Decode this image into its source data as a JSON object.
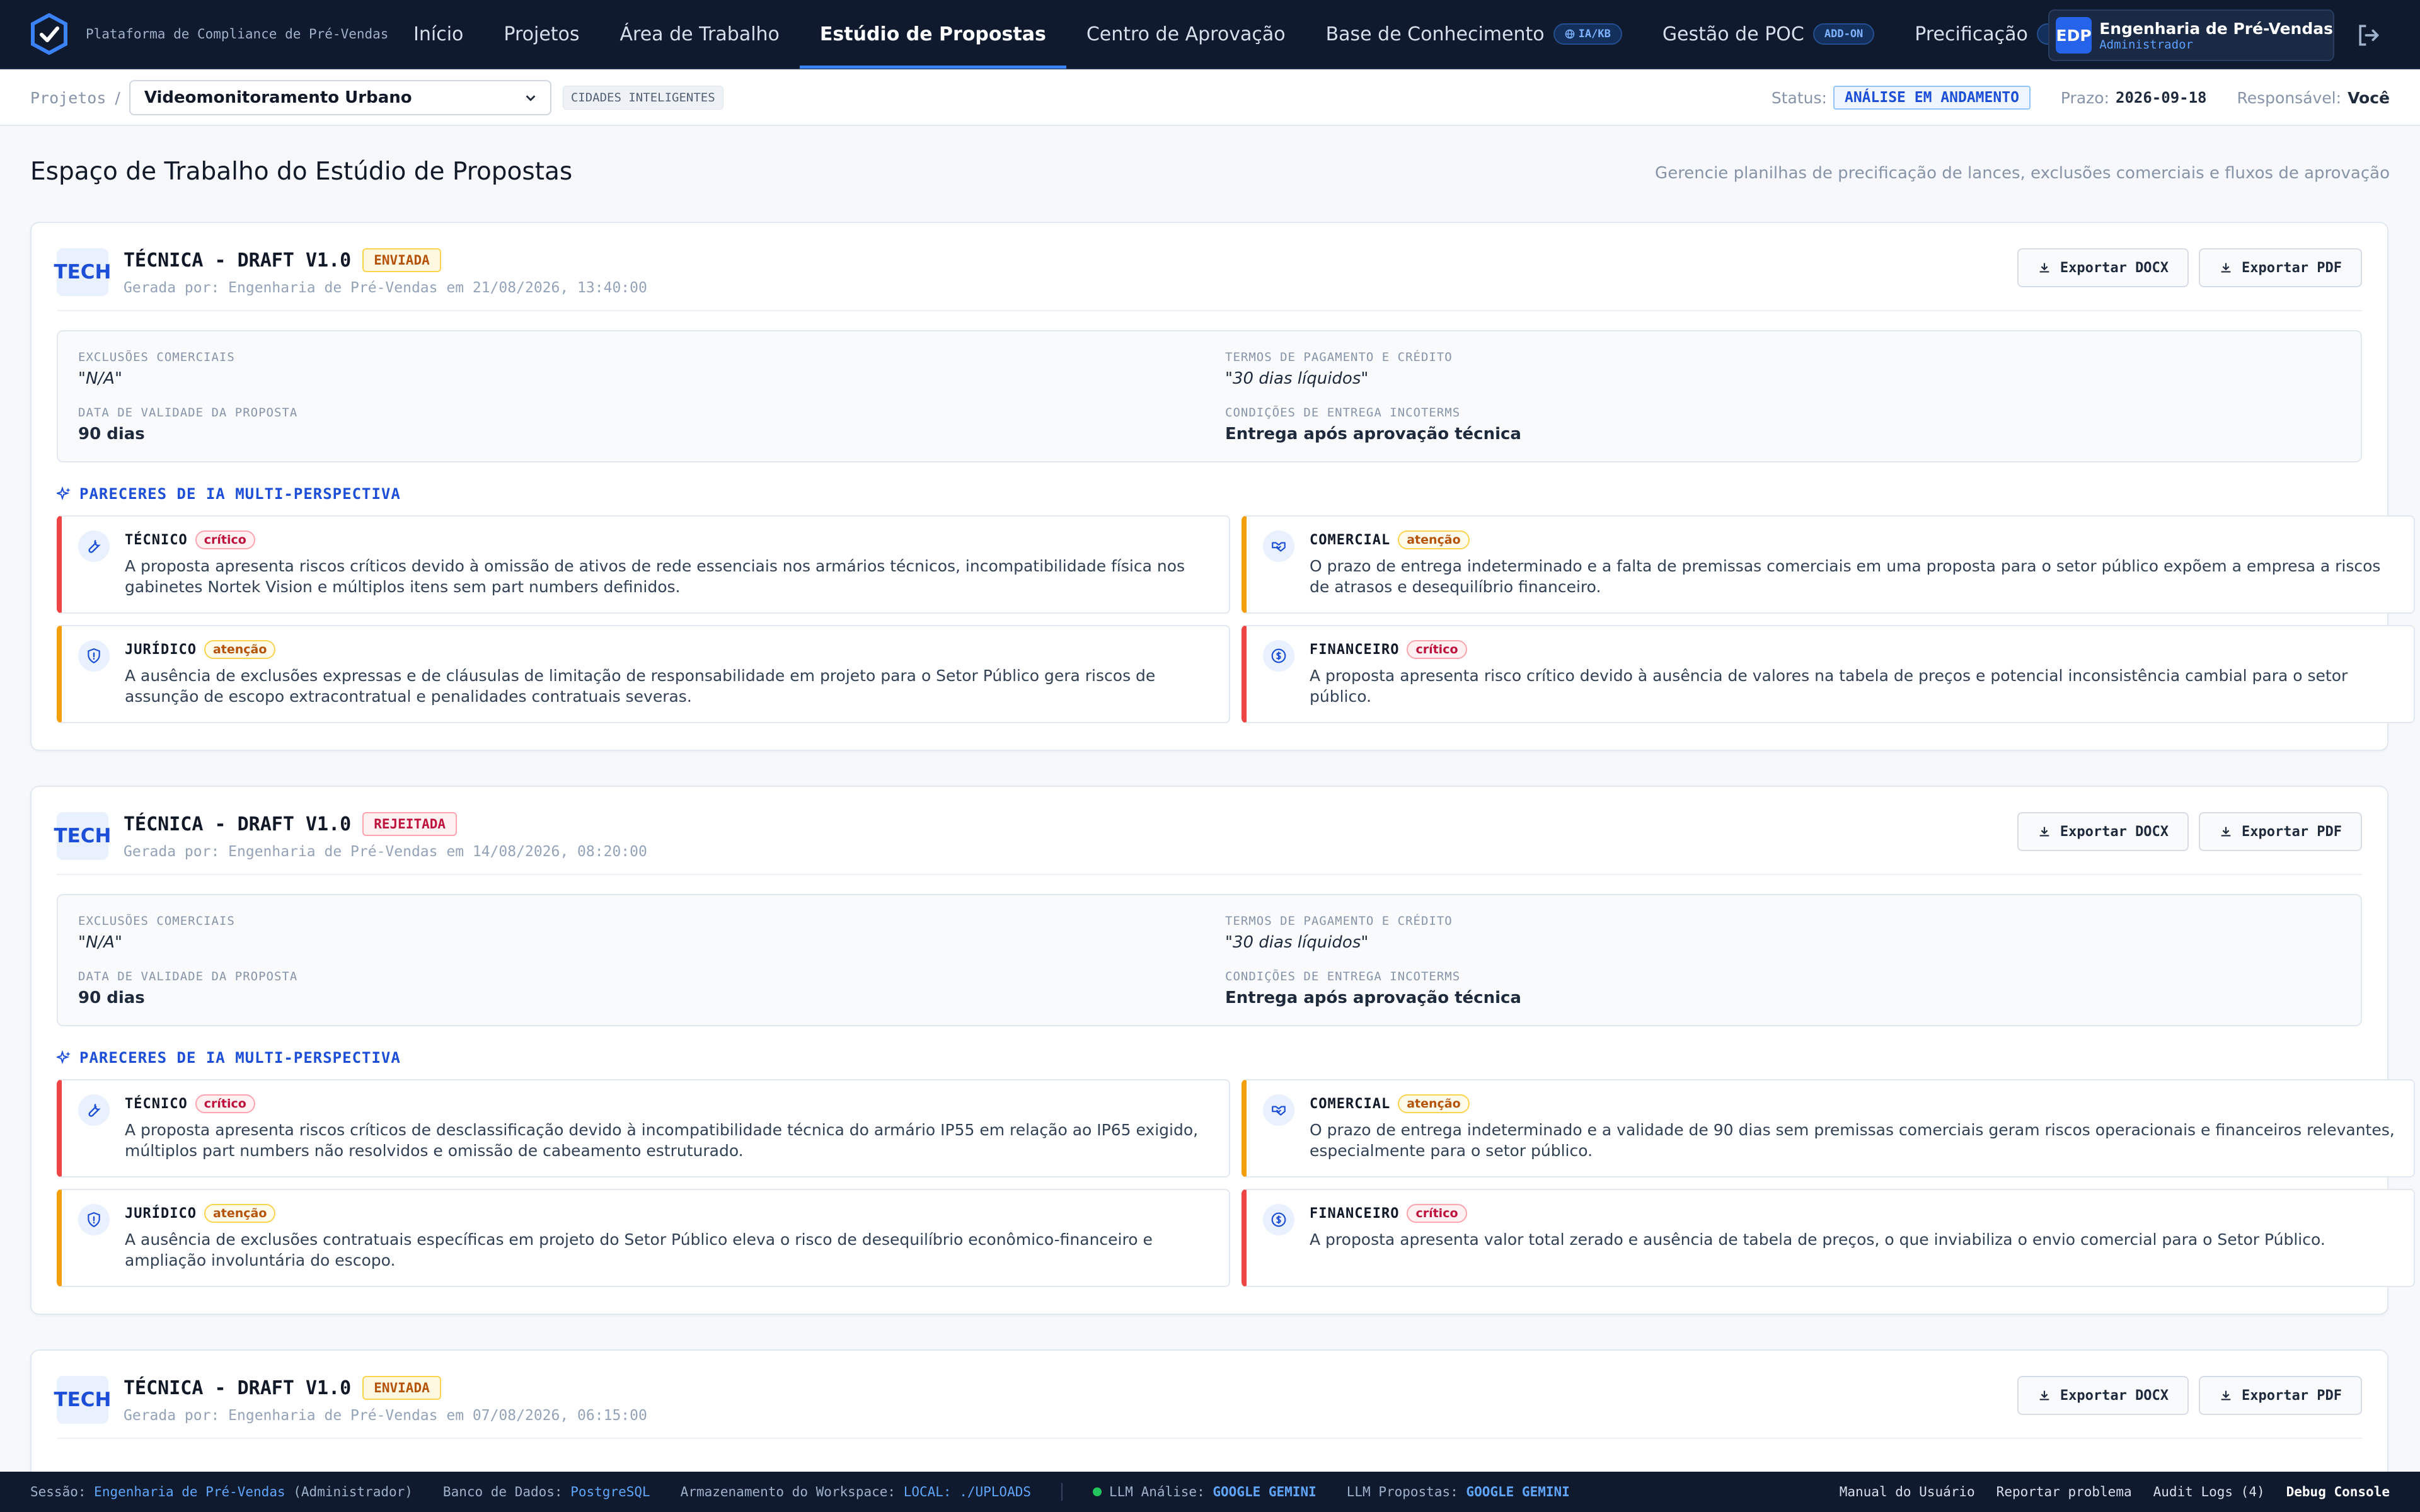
{
  "app": {
    "platform_name": "Plataforma de Compliance de Pré-Vendas"
  },
  "nav": {
    "items": [
      {
        "label": "Início",
        "active": false,
        "tag": null
      },
      {
        "label": "Projetos",
        "active": false,
        "tag": null
      },
      {
        "label": "Área de Trabalho",
        "active": false,
        "tag": null
      },
      {
        "label": "Estúdio de Propostas",
        "active": true,
        "tag": null
      },
      {
        "label": "Centro de Aprovação",
        "active": false,
        "tag": null
      },
      {
        "label": "Base de Conhecimento",
        "active": false,
        "tag": "IA/KB"
      },
      {
        "label": "Gestão de POC",
        "active": false,
        "tag": "ADD-ON"
      },
      {
        "label": "Precificação",
        "active": false,
        "tag": "ADD-ON"
      }
    ],
    "user": {
      "initials": "EDP",
      "name": "Engenharia de Pré-Vendas",
      "role": "Administrador"
    }
  },
  "subheader": {
    "crumb": "Projetos",
    "crumb_sep": "/",
    "project": "Videomonitoramento Urbano",
    "sector_tag": "CIDADES INTELIGENTES",
    "status_label": "Status:",
    "status_value": "ANÁLISE EM ANDAMENTO",
    "deadline_label": "Prazo:",
    "deadline_value": "2026-09-18",
    "owner_label": "Responsável:",
    "owner_value": "Você"
  },
  "page": {
    "title": "Espaço de Trabalho do Estúdio de Propostas",
    "description": "Gerencie planilhas de precificação de lances, exclusões comerciais e fluxos de aprovação"
  },
  "labels": {
    "tech_badge": "TECH",
    "export_docx": "Exportar DOCX",
    "export_pdf": "Exportar PDF",
    "exclusions": "EXCLUSÕES COMERCIAIS",
    "payment": "TERMOS DE PAGAMENTO E CRÉDITO",
    "validity": "DATA DE VALIDADE DA PROPOSTA",
    "delivery": "CONDIÇÕES DE ENTREGA INCOTERMS",
    "ai_section": "PARECERES DE IA MULTI-PERSPECTIVA"
  },
  "proposals": [
    {
      "title": "TÉCNICA - DRAFT V1.0",
      "state": "ENVIADA",
      "generated": "Gerada por: Engenharia de Pré-Vendas em 21/08/2026, 13:40:00",
      "exclusions": "\"N/A\"",
      "payment": "\"30 dias líquidos\"",
      "validity": "90 dias",
      "delivery": "Entrega após aprovação técnica",
      "opinions": [
        {
          "area": "TÉCNICO",
          "severity": "crítico",
          "text": "A proposta apresenta riscos críticos devido à omissão de ativos de rede essenciais nos armários técnicos, incompatibilidade física nos gabinetes Nortek Vision e múltiplos itens sem part numbers definidos."
        },
        {
          "area": "COMERCIAL",
          "severity": "atenção",
          "text": "O prazo de entrega indeterminado e a falta de premissas comerciais em uma proposta para o setor público expõem a empresa a riscos de atrasos e desequilíbrio financeiro."
        },
        {
          "area": "JURÍDICO",
          "severity": "atenção",
          "text": "A ausência de exclusões expressas e de cláusulas de limitação de responsabilidade em projeto para o Setor Público gera riscos de assunção de escopo extracontratual e penalidades contratuais severas."
        },
        {
          "area": "FINANCEIRO",
          "severity": "crítico",
          "text": "A proposta apresenta risco crítico devido à ausência de valores na tabela de preços e potencial inconsistência cambial para o setor público."
        }
      ]
    },
    {
      "title": "TÉCNICA - DRAFT V1.0",
      "state": "REJEITADA",
      "generated": "Gerada por: Engenharia de Pré-Vendas em 14/08/2026, 08:20:00",
      "exclusions": "\"N/A\"",
      "payment": "\"30 dias líquidos\"",
      "validity": "90 dias",
      "delivery": "Entrega após aprovação técnica",
      "opinions": [
        {
          "area": "TÉCNICO",
          "severity": "crítico",
          "text": "A proposta apresenta riscos críticos de desclassificação devido à incompatibilidade técnica do armário IP55 em relação ao IP65 exigido, múltiplos part numbers não resolvidos e omissão de cabeamento estruturado."
        },
        {
          "area": "COMERCIAL",
          "severity": "atenção",
          "text": "O prazo de entrega indeterminado e a validade de 90 dias sem premissas comerciais geram riscos operacionais e financeiros relevantes, especialmente para o setor público."
        },
        {
          "area": "JURÍDICO",
          "severity": "atenção",
          "text": "A ausência de exclusões contratuais específicas em projeto do Setor Público eleva o risco de desequilíbrio econômico-financeiro e ampliação involuntária do escopo."
        },
        {
          "area": "FINANCEIRO",
          "severity": "crítico",
          "text": "A proposta apresenta valor total zerado e ausência de tabela de preços, o que inviabiliza o envio comercial para o Setor Público."
        }
      ]
    },
    {
      "title": "TÉCNICA - DRAFT V1.0",
      "state": "ENVIADA",
      "generated": "Gerada por: Engenharia de Pré-Vendas em 07/08/2026, 06:15:00"
    }
  ],
  "footer": {
    "session_label": "Sessão:",
    "session_user": "Engenharia de Pré-Vendas",
    "session_role": "(Administrador)",
    "db_label": "Banco de Dados:",
    "db_value": "PostgreSQL",
    "storage_label": "Armazenamento do Workspace:",
    "storage_value": "LOCAL: ./UPLOADS",
    "llm_analysis_label": "LLM Análise:",
    "llm_analysis_value": "GOOGLE GEMINI",
    "llm_proposals_label": "LLM Propostas:",
    "llm_proposals_value": "GOOGLE GEMINI",
    "manual": "Manual do Usuário",
    "report": "Reportar problema",
    "audit": "Audit Logs (4)",
    "debug": "Debug Console"
  }
}
